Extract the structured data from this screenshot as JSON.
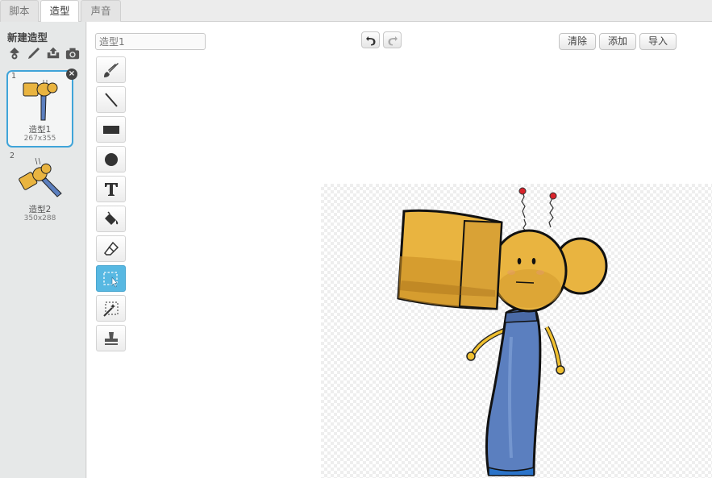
{
  "tabs": [
    {
      "label": "脚本"
    },
    {
      "label": "造型"
    },
    {
      "label": "声音"
    }
  ],
  "costume_pane": {
    "title": "新建造型",
    "new_icons": [
      "paint-sprite-icon",
      "brush-icon",
      "upload-icon",
      "camera-icon"
    ],
    "costumes": [
      {
        "number": "1",
        "name": "造型1",
        "size": "267x355",
        "selected": true
      },
      {
        "number": "2",
        "name": "造型2",
        "size": "350x288",
        "selected": false
      }
    ]
  },
  "editor": {
    "costume_name_placeholder": "造型1",
    "buttons": {
      "clear": "清除",
      "add": "添加",
      "import": "导入"
    },
    "tools": [
      "brush-icon",
      "line-icon",
      "rectangle-icon",
      "ellipse-icon",
      "text-icon",
      "fill-icon",
      "eraser-icon",
      "select-icon",
      "magic-select-icon",
      "stamp-icon"
    ],
    "active_tool": "select-icon"
  },
  "colors": {
    "accent": "#3fa4d9",
    "active_tool": "#57b8e2",
    "hammer_yellow": "#e9b440",
    "handle_blue": "#5b7fbf"
  }
}
